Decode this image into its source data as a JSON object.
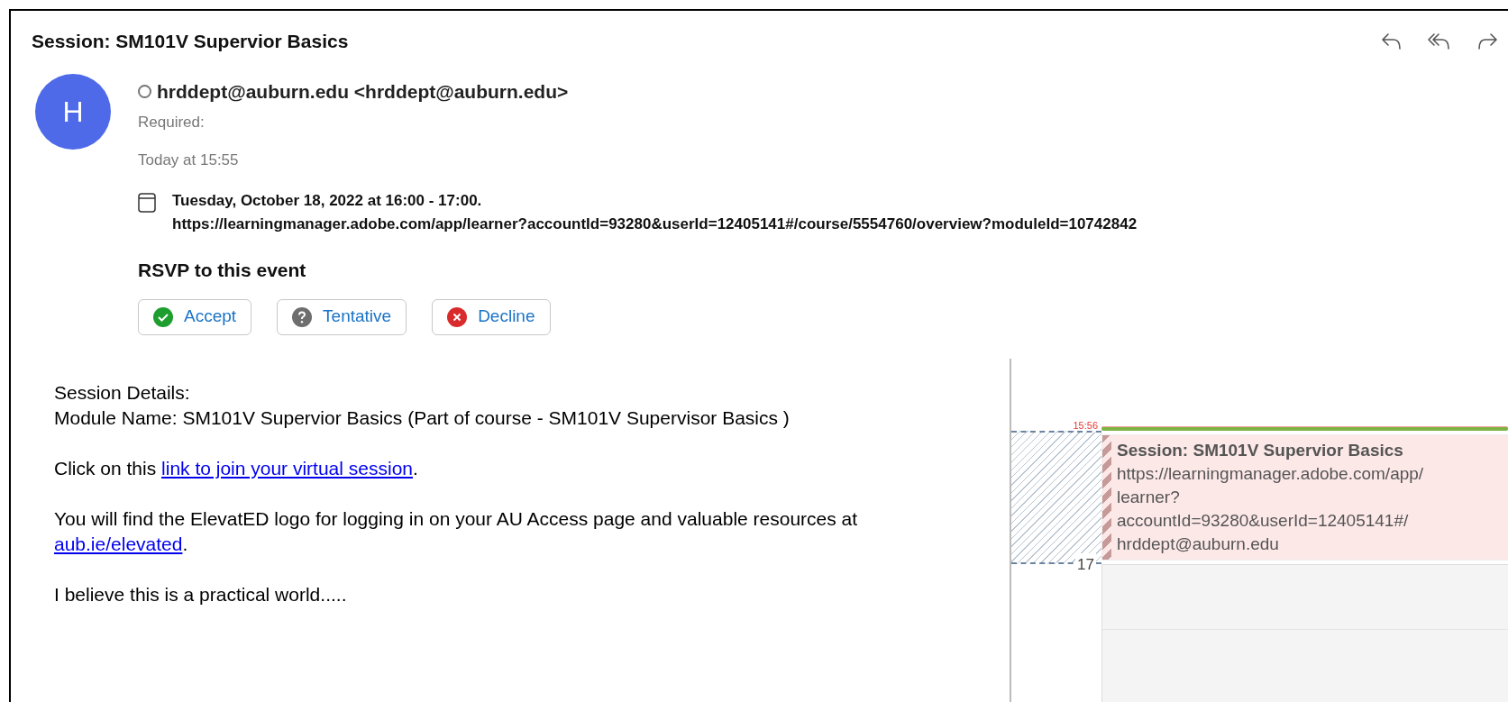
{
  "subject": "Session: SM101V Supervior Basics",
  "toolbar": [
    {
      "kind": "reply"
    },
    {
      "kind": "reply-all"
    },
    {
      "kind": "forward"
    }
  ],
  "sender": {
    "initial": "H",
    "name": "hrddept@auburn.edu <hrddept@auburn.edu>",
    "required_label": "Required:",
    "time": "Today at 15:55"
  },
  "event": {
    "when": "Tuesday, October 18, 2022 at 16:00 - 17:00.",
    "url": "https://learningmanager.adobe.com/app/learner?accountId=93280&userId=12405141#/course/5554760/overview?moduleId=10742842"
  },
  "rsvp": {
    "title": "RSVP to this event",
    "buttons": [
      {
        "kind": "accept",
        "label": "Accept"
      },
      {
        "kind": "tentative",
        "label": "Tentative"
      },
      {
        "kind": "decline",
        "label": "Decline"
      }
    ]
  },
  "body": [
    {
      "lines": [
        "Session Details:",
        "Module Name: SM101V Supervior Basics (Part of course - SM101V Supervisor Basics )"
      ]
    },
    {
      "before": "Click on this ",
      "link": "link to join your virtual session",
      "after": "."
    },
    {
      "before": "You will find the ElevatED logo for logging in on your AU Access page and valuable resources at ",
      "link": "aub.ie/elevated",
      "after": "."
    },
    {
      "lines": [
        "I believe this is a practical world....."
      ]
    }
  ],
  "calendar": {
    "now_time": "15:56",
    "hour_label": "17",
    "event_title": "Session: SM101V Supervior Basics",
    "event_lines": [
      "https://learningmanager.adobe.com/app/",
      "learner?",
      "accountId=93280&userId=12405141#/",
      "hrddept@auburn.edu"
    ]
  }
}
